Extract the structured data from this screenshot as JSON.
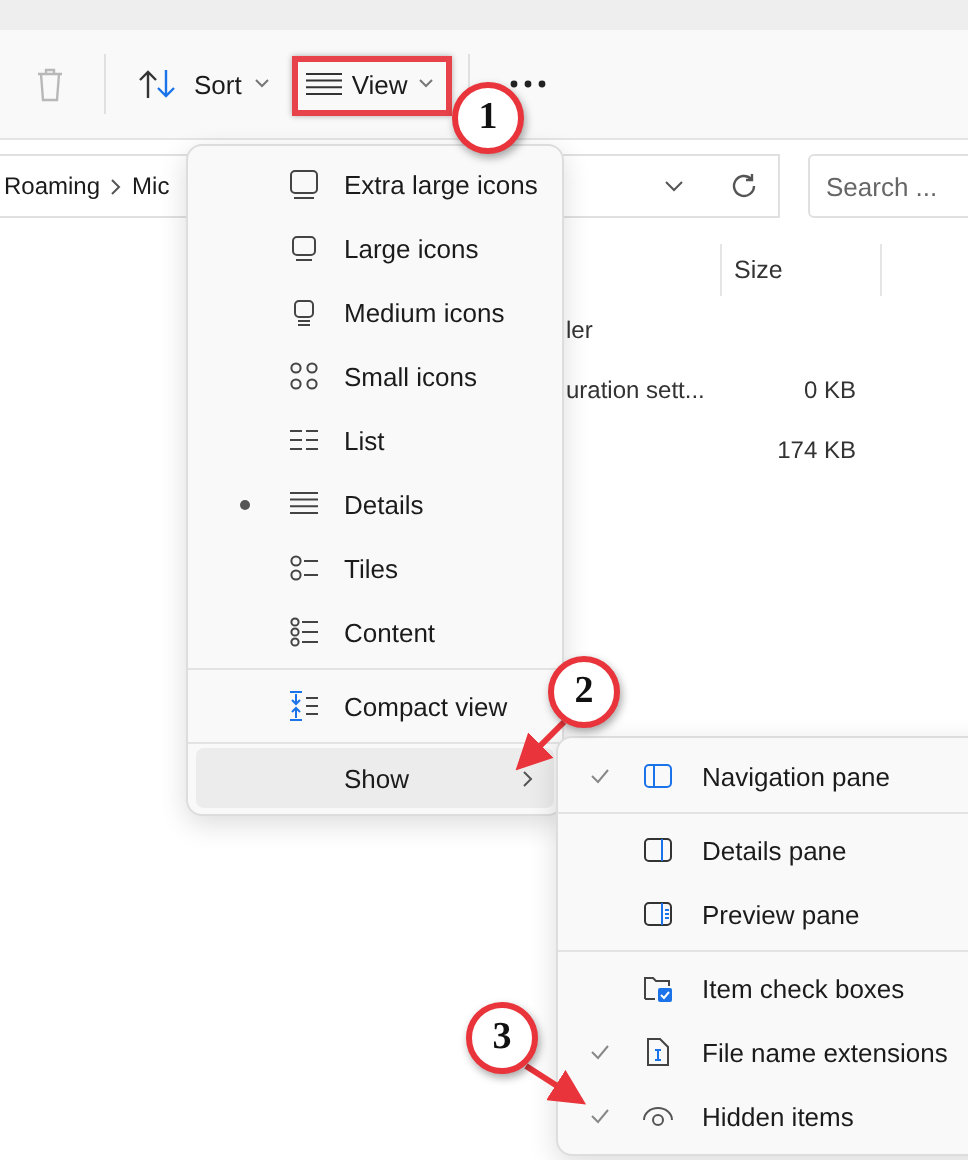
{
  "toolbar": {
    "sort": "Sort",
    "view": "View"
  },
  "address": {
    "crumbs": [
      "Roaming",
      "Mic"
    ]
  },
  "search": {
    "placeholder": "Search ..."
  },
  "table": {
    "size_header": "Size",
    "rows": [
      {
        "column_1": "ler"
      },
      {
        "column_1": "uration sett...",
        "size": "0 KB"
      },
      {
        "size": "174 KB"
      }
    ]
  },
  "view_menu": {
    "items": [
      {
        "label": "Extra large icons",
        "selected": false
      },
      {
        "label": "Large icons",
        "selected": false
      },
      {
        "label": "Medium icons",
        "selected": false
      },
      {
        "label": "Small icons",
        "selected": false
      },
      {
        "label": "List",
        "selected": false
      },
      {
        "label": "Details",
        "selected": true
      },
      {
        "label": "Tiles",
        "selected": false
      },
      {
        "label": "Content",
        "selected": false
      }
    ],
    "compact": {
      "label": "Compact view"
    },
    "show": {
      "label": "Show",
      "expanded": true
    }
  },
  "show_menu": {
    "groups": [
      [
        {
          "label": "Navigation pane",
          "checked": true
        }
      ],
      [
        {
          "label": "Details pane",
          "checked": false
        },
        {
          "label": "Preview pane",
          "checked": false
        }
      ],
      [
        {
          "label": "Item check boxes",
          "checked": false
        },
        {
          "label": "File name extensions",
          "checked": true
        },
        {
          "label": "Hidden items",
          "checked": true
        }
      ]
    ]
  },
  "annotations": [
    {
      "label": "1"
    },
    {
      "label": "2"
    },
    {
      "label": "3"
    }
  ]
}
